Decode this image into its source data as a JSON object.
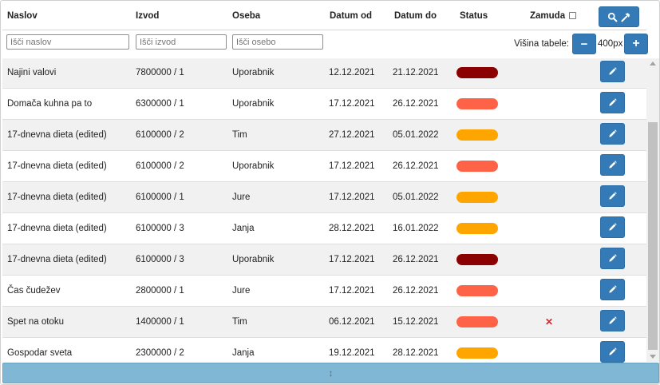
{
  "header": {
    "naslov": "Naslov",
    "izvod": "Izvod",
    "oseba": "Oseba",
    "datum_od": "Datum od",
    "datum_do": "Datum do",
    "status": "Status",
    "zamuda": "Zamuda",
    "zamuda_checked": false,
    "search_button_icons": [
      "search-icon",
      "hammer-icon"
    ]
  },
  "filters": {
    "naslov_placeholder": "Išči naslov",
    "izvod_placeholder": "Išči izvod",
    "oseba_placeholder": "Išči osebo",
    "visina_label": "Višina tabele:",
    "visina_value": "400px",
    "minus_label": "−",
    "plus_label": "+"
  },
  "colors": {
    "primary_button": "#337ab7",
    "status_dark_red": "#8b0000",
    "status_tomato": "#ff6347",
    "status_orange": "#ffa500",
    "late_mark": "#d9232a",
    "resize_bar": "#7fb7d4"
  },
  "rows": [
    {
      "naslov": "Najini valovi",
      "izvod": "7800000 / 1",
      "oseba": "Uporabnik",
      "od": "12.12.2021",
      "do": "21.12.2021",
      "status_color": "#8b0000",
      "zamuda": ""
    },
    {
      "naslov": "Domača kuhna pa to",
      "izvod": "6300000 / 1",
      "oseba": "Uporabnik",
      "od": "17.12.2021",
      "do": "26.12.2021",
      "status_color": "#ff6347",
      "zamuda": ""
    },
    {
      "naslov": "17-dnevna dieta (edited)",
      "izvod": "6100000 / 2",
      "oseba": "Tim",
      "od": "27.12.2021",
      "do": "05.01.2022",
      "status_color": "#ffa500",
      "zamuda": ""
    },
    {
      "naslov": "17-dnevna dieta (edited)",
      "izvod": "6100000 / 2",
      "oseba": "Uporabnik",
      "od": "17.12.2021",
      "do": "26.12.2021",
      "status_color": "#ff6347",
      "zamuda": ""
    },
    {
      "naslov": "17-dnevna dieta (edited)",
      "izvod": "6100000 / 1",
      "oseba": "Jure",
      "od": "17.12.2021",
      "do": "05.01.2022",
      "status_color": "#ffa500",
      "zamuda": ""
    },
    {
      "naslov": "17-dnevna dieta (edited)",
      "izvod": "6100000 / 3",
      "oseba": "Janja",
      "od": "28.12.2021",
      "do": "16.01.2022",
      "status_color": "#ffa500",
      "zamuda": ""
    },
    {
      "naslov": "17-dnevna dieta (edited)",
      "izvod": "6100000 / 3",
      "oseba": "Uporabnik",
      "od": "17.12.2021",
      "do": "26.12.2021",
      "status_color": "#8b0000",
      "zamuda": ""
    },
    {
      "naslov": "Čas čudežev",
      "izvod": "2800000 / 1",
      "oseba": "Jure",
      "od": "17.12.2021",
      "do": "26.12.2021",
      "status_color": "#ff6347",
      "zamuda": ""
    },
    {
      "naslov": "Spet na otoku",
      "izvod": "1400000 / 1",
      "oseba": "Tim",
      "od": "06.12.2021",
      "do": "15.12.2021",
      "status_color": "#ff6347",
      "zamuda": "✕"
    },
    {
      "naslov": "Gospodar sveta",
      "izvod": "2300000 / 2",
      "oseba": "Janja",
      "od": "19.12.2021",
      "do": "28.12.2021",
      "status_color": "#ffa500",
      "zamuda": ""
    }
  ],
  "resize_handle_glyph": "↕"
}
